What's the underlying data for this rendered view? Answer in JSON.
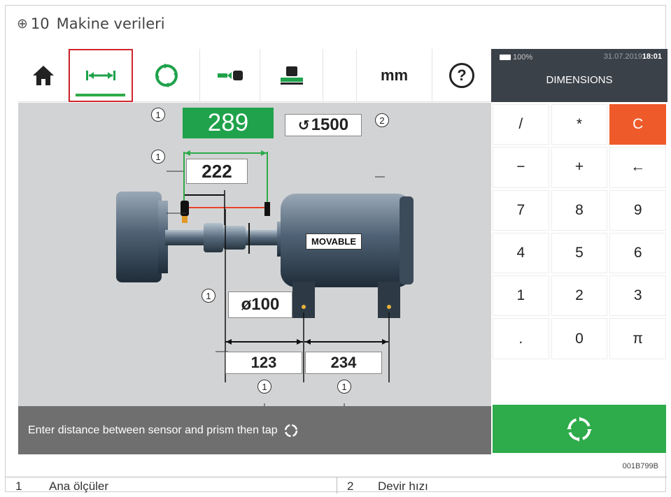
{
  "figure": {
    "number": "10",
    "title": "Makine verileri",
    "code": "001B799B"
  },
  "toolbar": {
    "unit_label": "mm",
    "help_label": "?"
  },
  "status": {
    "battery": "100%",
    "date": "31.07.2019",
    "time": "18:01",
    "panel_title": "DIMENSIONS"
  },
  "measurements": {
    "sensor_prism": "289",
    "rpm": "1500",
    "sensor_coupling": "222",
    "coupling_diameter": "ø100",
    "coupling_to_front_feet": "123",
    "front_to_rear_feet": "234"
  },
  "machine_label": "MOVABLE",
  "callouts": {
    "one": "1",
    "two": "2"
  },
  "message": "Enter distance between sensor and prism then tap",
  "keypad": {
    "keys": [
      "/",
      "*",
      "C",
      "−",
      "+",
      "←",
      "7",
      "8",
      "9",
      "4",
      "5",
      "6",
      "1",
      "2",
      "3",
      ".",
      "0",
      "π"
    ]
  },
  "legend": [
    {
      "num": "1",
      "text": "Ana ölçüler"
    },
    {
      "num": "2",
      "text": "Devir hızı"
    }
  ],
  "colors": {
    "accent_green": "#2eab4a",
    "clear_orange": "#ee5a2a",
    "selected_red": "#d0262d",
    "dark_panel": "#3a4149"
  }
}
